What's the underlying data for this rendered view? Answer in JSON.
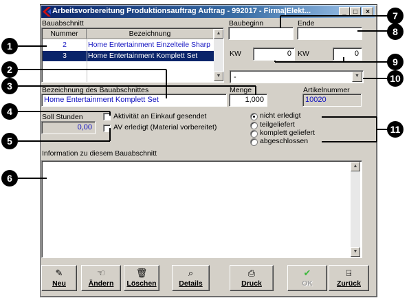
{
  "window": {
    "title": "Arbeitsvorbereitung Produktionsauftrag  Auftrag - 992017 - Firma|Elekt...",
    "controls": {
      "minimize": "_",
      "maximize": "□",
      "close": "×"
    }
  },
  "section_table": {
    "group_label": "Bauabschnitt",
    "columns": [
      "Nummer",
      "Bezeichnung"
    ],
    "rows": [
      {
        "nummer": "2",
        "bezeichnung": "Home Entertainment Einzelteile Sharp",
        "selected": false
      },
      {
        "nummer": "3",
        "bezeichnung": "Home Entertainment Komplett Set",
        "selected": true
      }
    ]
  },
  "schedule": {
    "baubeginn_label": "Baubeginn",
    "baubeginn_value": "",
    "ende_label": "Ende",
    "ende_value": "",
    "kw_label_start": "KW",
    "kw_start_value": "0",
    "kw_label_end": "KW",
    "kw_end_value": "0",
    "dropdown_value": "-"
  },
  "details": {
    "bezeichnung_label": "Bezeichnung des Bauabschnittes",
    "bezeichnung_value": "Home Entertainment Komplett Set",
    "menge_label": "Menge",
    "menge_value": "1,000",
    "artikelnummer_label": "Artikelnummer",
    "artikelnummer_value": "10020",
    "soll_stunden_label": "Soll Stunden",
    "soll_stunden_value": "0,00"
  },
  "checkboxes": [
    {
      "label": "Aktivität an Einkauf gesendet",
      "checked": false
    },
    {
      "label": "AV erledigt (Material vorbereitet)",
      "checked": false
    }
  ],
  "status_radios": [
    {
      "label": "nicht erledigt",
      "selected": true
    },
    {
      "label": "teilgeliefert",
      "selected": false
    },
    {
      "label": "komplett geliefert",
      "selected": false
    },
    {
      "label": "abgeschlossen",
      "selected": false
    }
  ],
  "info": {
    "label": "Information zu diesem Bauabschnitt",
    "value": ""
  },
  "toolbar": [
    {
      "label": "Neu",
      "icon": "pencil-icon",
      "enabled": true
    },
    {
      "label": "Ändern",
      "icon": "edit-hand-icon",
      "enabled": true
    },
    {
      "label": "Löschen",
      "icon": "trash-icon",
      "enabled": true
    },
    {
      "label": "Details",
      "icon": "magnifier-icon",
      "enabled": true
    },
    {
      "label": "Druck",
      "icon": "printer-icon",
      "enabled": true
    },
    {
      "label": "OK",
      "icon": "checkmark-icon",
      "enabled": false
    },
    {
      "label": "Zurück",
      "icon": "exit-door-icon",
      "enabled": true
    }
  ],
  "callouts": [
    "1",
    "2",
    "3",
    "4",
    "5",
    "6",
    "7",
    "8",
    "9",
    "10",
    "11"
  ],
  "colors": {
    "title_start": "#0a246a",
    "title_end": "#a6caf0",
    "selection": "#0a246a",
    "value_text": "#1010c0",
    "face": "#d4d0c8"
  }
}
